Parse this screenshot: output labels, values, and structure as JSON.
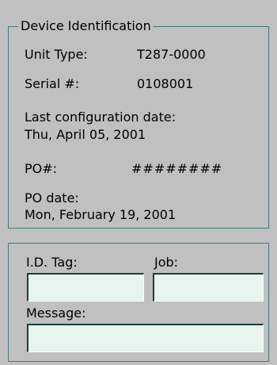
{
  "device_identification": {
    "title": "Device Identification",
    "unit_type_label": "Unit Type:",
    "unit_type_value": "T287-0000",
    "serial_label": "Serial #:",
    "serial_value": "0108001",
    "last_config_label": "Last configuration date:",
    "last_config_value": "Thu, April 05, 2001",
    "po_label": "PO#:",
    "po_value": "########",
    "po_date_label": "PO date:",
    "po_date_value": "Mon, February 19, 2001"
  },
  "tag_section": {
    "id_tag_label": "I.D. Tag:",
    "id_tag_value": "",
    "job_label": "Job:",
    "job_value": "",
    "message_label": "Message:",
    "message_value": ""
  }
}
